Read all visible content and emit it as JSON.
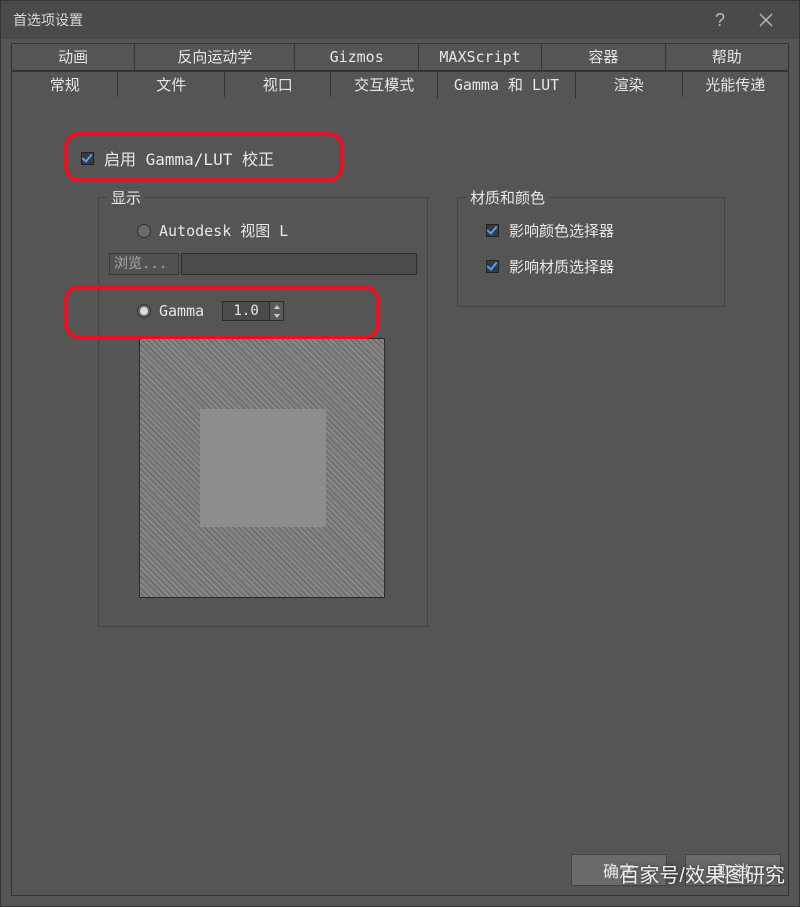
{
  "window": {
    "title": "首选项设置"
  },
  "tabs_top": [
    "动画",
    "反向运动学",
    "Gizmos",
    "MAXScript",
    "容器",
    "帮助"
  ],
  "tabs_bottom": [
    "常规",
    "文件",
    "视口",
    "交互模式",
    "Gamma 和 LUT",
    "渲染",
    "光能传递"
  ],
  "active_tab": "Gamma 和 LUT",
  "enable": {
    "label": "启用 Gamma/LUT 校正",
    "checked": true
  },
  "display_group": {
    "legend": "显示",
    "autodesk_label": "Autodesk 视图 L",
    "browse_label": "浏览...",
    "browse_value": "",
    "gamma_label": "Gamma",
    "gamma_value": "1.0",
    "gamma_selected": true
  },
  "material_group": {
    "legend": "材质和颜色",
    "opt1": {
      "label": "影响颜色选择器",
      "checked": true
    },
    "opt2": {
      "label": "影响材质选择器",
      "checked": true
    }
  },
  "footer": {
    "ok": "确定",
    "cancel": "取消"
  },
  "watermark": "百家号/效果图研究"
}
